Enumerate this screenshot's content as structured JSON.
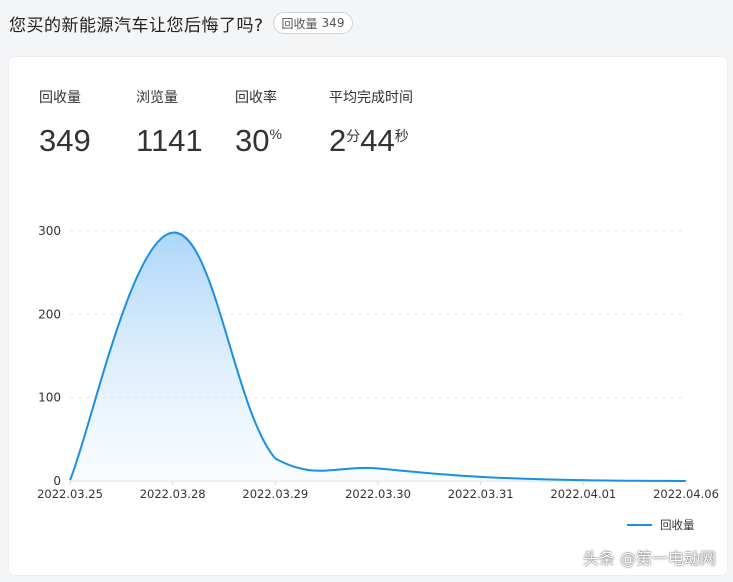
{
  "header": {
    "title": "您买的新能源汽车让您后悔了吗?",
    "badge_label": "回收量",
    "badge_value": "349"
  },
  "stats": {
    "received": {
      "label": "回收量",
      "value": "349"
    },
    "views": {
      "label": "浏览量",
      "value": "1141"
    },
    "rate": {
      "label": "回收率",
      "value": "30",
      "unit": "%"
    },
    "avg_time": {
      "label": "平均完成时间",
      "minutes": "2",
      "minutes_unit": "分",
      "seconds": "44",
      "seconds_unit": "秒"
    }
  },
  "chart_data": {
    "type": "area",
    "x": [
      "2022.03.25",
      "2022.03.28",
      "2022.03.29",
      "2022.03.30",
      "2022.03.31",
      "2022.04.01",
      "2022.04.06"
    ],
    "series": [
      {
        "name": "回收量",
        "values": [
          1,
          298,
          27,
          15,
          5,
          1,
          0
        ]
      }
    ],
    "yticks": [
      0,
      100,
      200,
      300
    ],
    "ylim": [
      0,
      300
    ],
    "grid": true,
    "legend": "bottom-right",
    "colors": {
      "line": "#1a8fe3",
      "fill_top": "#a9d4f8",
      "fill_bottom": "#eef7fe"
    }
  },
  "watermark": "头条 @第一电动网"
}
